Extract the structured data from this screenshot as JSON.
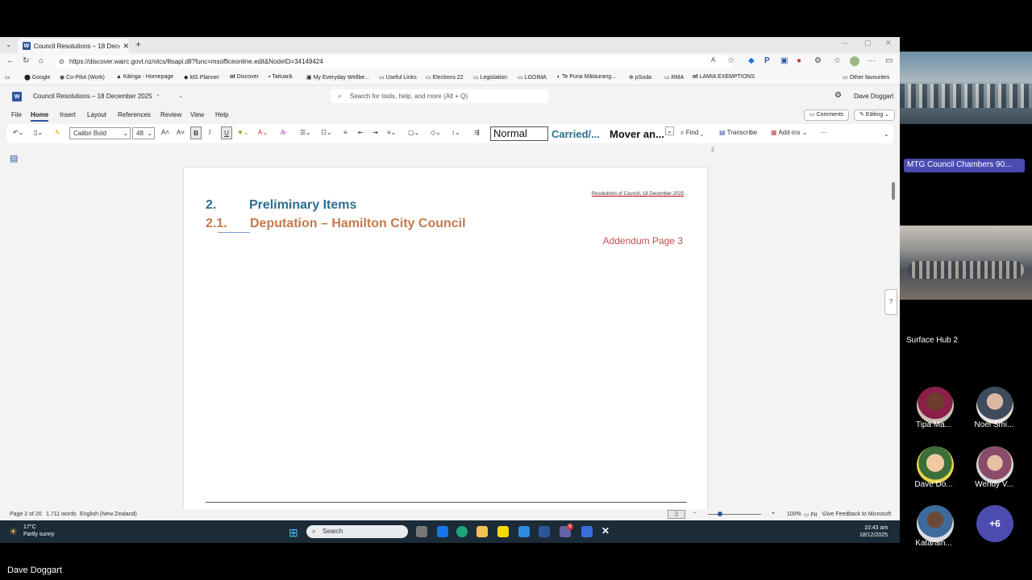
{
  "browser": {
    "tab_title": "Council Resolutions – 18 Decemb",
    "url": "https://discover.wairc.govt.nz/otcs/llisapi.dll?func=msofficeonline.edit&NodeID=34149424",
    "favourites": [
      "Google",
      "Co-Pilot (Work)",
      "Kāinga - Homepage",
      "MS Planner",
      "Discover",
      "Taituarā",
      "My Everyday Wellbe...",
      "Useful Links",
      "Elections 22",
      "Legislation",
      "LGOIMA",
      "Te Puna Mātaurang...",
      "pSoda",
      "RMA",
      "LAMIA EXEMPTIONS"
    ],
    "other_favourites": "Other favourites"
  },
  "word": {
    "doc_title": "Council Resolutions – 18 December 2025",
    "search_placeholder": "Search for tools, help, and more (Alt + Q)",
    "user": "Dave Doggart",
    "tabs": [
      "File",
      "Home",
      "Insert",
      "Layout",
      "References",
      "Review",
      "View",
      "Help"
    ],
    "comments_label": "Comments",
    "editing_label": "Editing",
    "font_name": "Calibri Bold",
    "font_size": "48",
    "styles": [
      "Normal",
      "Carried/...",
      "Mover an..."
    ],
    "find_label": "Find",
    "transcribe_label": "Transcribe",
    "addins_label": "Add-ins",
    "page_marker": "2"
  },
  "document": {
    "running_head": "Resolutions of Council, 18 December 2025",
    "heading_num": "2.",
    "heading_text": "Preliminary Items",
    "sub_num": "2.1.",
    "sub_text": "Deputation – Hamilton City Council",
    "addendum": "Addendum Page 3"
  },
  "status": {
    "page": "Page 2 of 20",
    "words": "1,711 words",
    "language": "English (New Zealand)",
    "zoom": "100%",
    "fit": "Fit",
    "feedback": "Give Feedback to Microsoft"
  },
  "taskbar": {
    "weather_temp": "17°C",
    "weather_desc": "Partly sunny",
    "search": "Search",
    "time": "10:43 am",
    "date": "18/12/2025",
    "teams_badge": "6"
  },
  "meeting": {
    "room_label": "MTG Council Chambers 90...",
    "surface_label": "Surface Hub 2",
    "participants": [
      "Tipa Ma...",
      "Noel Smi...",
      "Dave Do...",
      "Wendy V...",
      "Katarain..."
    ],
    "more_count": "+6",
    "presenter": "Dave Doggart"
  }
}
